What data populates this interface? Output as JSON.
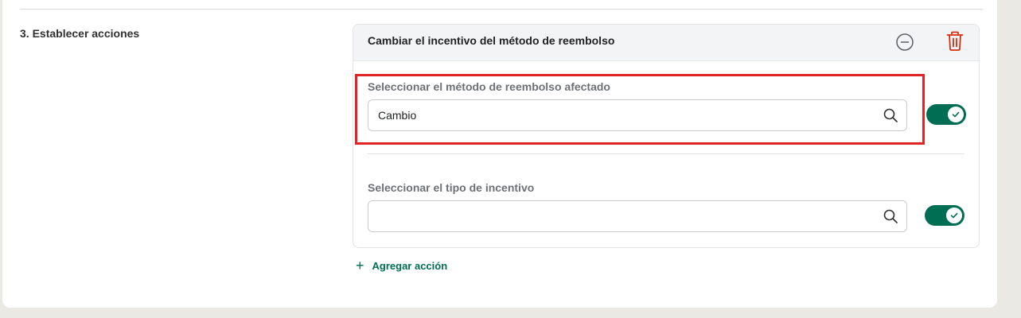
{
  "section": {
    "label": "3. Establecer acciones"
  },
  "action_card": {
    "title": "Cambiar el incentivo del método de reembolso",
    "remove_icon": "minus-circle-icon",
    "delete_icon": "trash-icon",
    "fields": [
      {
        "label": "Seleccionar el método de reembolso afectado",
        "value": "Cambio",
        "placeholder": "",
        "icon": "search-icon",
        "toggle_on": true
      },
      {
        "label": "Seleccionar el tipo de incentivo",
        "value": "",
        "placeholder": "",
        "icon": "search-icon",
        "toggle_on": true
      }
    ]
  },
  "add_action": {
    "label": "Agregar acción",
    "icon": "plus-icon"
  },
  "colors": {
    "accent": "#006e52",
    "delete": "#d72c0d",
    "highlight": "#e02424",
    "background": "#ebe9e3"
  }
}
